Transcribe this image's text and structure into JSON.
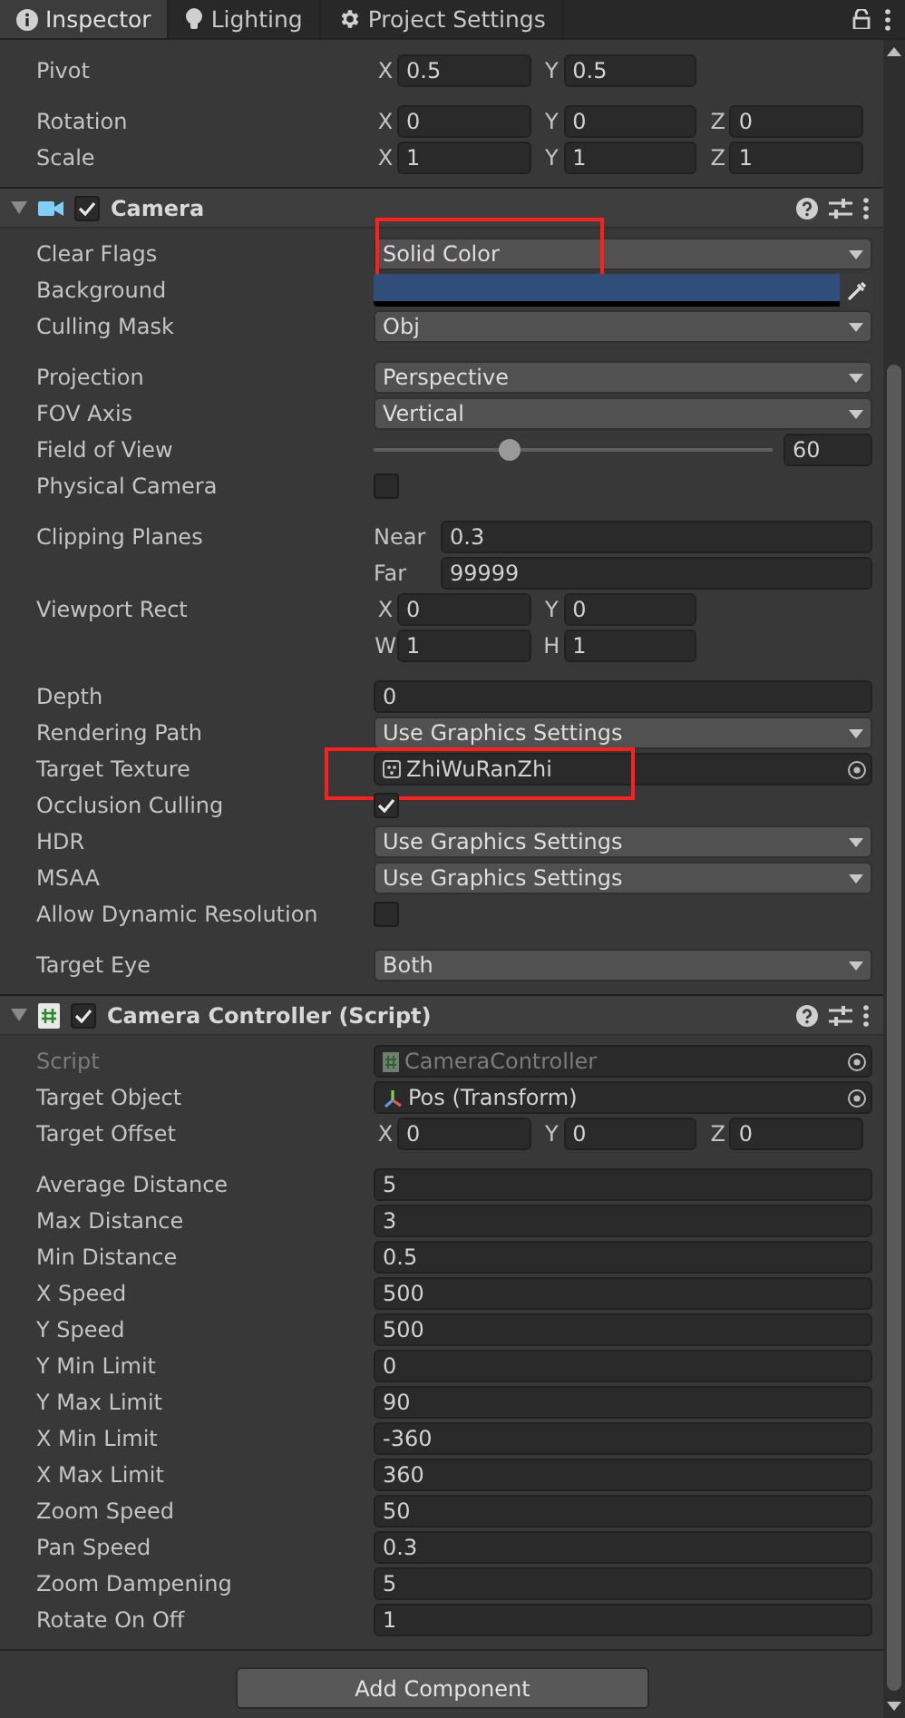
{
  "tabs": [
    {
      "label": "Inspector",
      "kind": "info",
      "selected": true
    },
    {
      "label": "Lighting",
      "kind": "bulb",
      "selected": false
    },
    {
      "label": "Project Settings",
      "kind": "gear",
      "selected": false
    }
  ],
  "components": [
    {
      "kind": "tail",
      "rows": [
        {
          "kind": "vector",
          "label": "Pivot",
          "fields": [
            {
              "axis": "X",
              "value": "0.5"
            },
            {
              "axis": "Y",
              "value": "0.5"
            }
          ]
        },
        {
          "kind": "vector",
          "label": "Rotation",
          "spaced": true,
          "fields": [
            {
              "axis": "X",
              "value": "0"
            },
            {
              "axis": "Y",
              "value": "0"
            },
            {
              "axis": "Z",
              "value": "0"
            }
          ]
        },
        {
          "kind": "vector",
          "label": "Scale",
          "fields": [
            {
              "axis": "X",
              "value": "1"
            },
            {
              "axis": "Y",
              "value": "1"
            },
            {
              "axis": "Z",
              "value": "1"
            }
          ]
        }
      ]
    },
    {
      "kind": "camera",
      "title": "Camera",
      "expanded": true,
      "enabled": true,
      "rows": [
        {
          "kind": "dropdown",
          "label": "Clear Flags",
          "value": "Solid Color",
          "highlighted": true
        },
        {
          "kind": "color",
          "label": "Background",
          "color": "#314d79"
        },
        {
          "kind": "dropdown",
          "label": "Culling Mask",
          "value": "Obj"
        },
        {
          "kind": "dropdown",
          "label": "Projection",
          "value": "Perspective",
          "spaced": true
        },
        {
          "kind": "dropdown",
          "label": "FOV Axis",
          "value": "Vertical"
        },
        {
          "kind": "slider",
          "label": "Field of View",
          "level": 0.34,
          "value": "60"
        },
        {
          "kind": "checkbox",
          "label": "Physical Camera",
          "checked": false
        },
        {
          "kind": "named",
          "label": "Clipping Planes",
          "spaced": true,
          "fields": [
            {
              "axis": "Near",
              "value": "0.3"
            }
          ]
        },
        {
          "kind": "named",
          "fields": [
            {
              "axis": "Far",
              "value": "99999"
            }
          ]
        },
        {
          "kind": "vector",
          "label": "Viewport Rect",
          "fields": [
            {
              "axis": "X",
              "value": "0"
            },
            {
              "axis": "Y",
              "value": "0"
            }
          ]
        },
        {
          "kind": "vector",
          "fields": [
            {
              "axis": "W",
              "value": "1"
            },
            {
              "axis": "H",
              "value": "1"
            }
          ]
        },
        {
          "kind": "number",
          "label": "Depth",
          "value": "0",
          "spaced": true
        },
        {
          "kind": "dropdown",
          "label": "Rendering Path",
          "value": "Use Graphics Settings"
        },
        {
          "kind": "texture",
          "label": "Target Texture",
          "value": "ZhiWuRanZhi",
          "disabled": false,
          "highlighted": true
        },
        {
          "kind": "checkbox",
          "label": "Occlusion Culling",
          "checked": true
        },
        {
          "kind": "dropdown",
          "label": "HDR",
          "value": "Use Graphics Settings"
        },
        {
          "kind": "dropdown",
          "label": "MSAA",
          "value": "Use Graphics Settings"
        },
        {
          "kind": "checkbox",
          "label": "Allow Dynamic Resolution",
          "checked": false
        },
        {
          "kind": "dropdown",
          "label": "Target Eye",
          "value": "Both",
          "spaced": true
        }
      ]
    },
    {
      "kind": "script",
      "title": "Camera Controller (Script)",
      "expanded": true,
      "enabled": true,
      "rows": [
        {
          "kind": "script",
          "label": "Script",
          "value": "CameraController",
          "disabled": true
        },
        {
          "kind": "transform",
          "label": "Target Object",
          "value": "Pos (Transform)",
          "disabled": false
        },
        {
          "kind": "vector",
          "label": "Target Offset",
          "fields": [
            {
              "axis": "X",
              "value": "0"
            },
            {
              "axis": "Y",
              "value": "0"
            },
            {
              "axis": "Z",
              "value": "0"
            }
          ]
        },
        {
          "kind": "number",
          "label": "Average Distance",
          "value": "5",
          "spaced": true
        },
        {
          "kind": "number",
          "label": "Max Distance",
          "value": "3"
        },
        {
          "kind": "number",
          "label": "Min Distance",
          "value": "0.5"
        },
        {
          "kind": "number",
          "label": "X Speed",
          "value": "500"
        },
        {
          "kind": "number",
          "label": "Y Speed",
          "value": "500"
        },
        {
          "kind": "number",
          "label": "Y Min Limit",
          "value": "0"
        },
        {
          "kind": "number",
          "label": "Y Max Limit",
          "value": "90"
        },
        {
          "kind": "number",
          "label": "X Min Limit",
          "value": "-360"
        },
        {
          "kind": "number",
          "label": "X Max Limit",
          "value": "360"
        },
        {
          "kind": "number",
          "label": "Zoom Speed",
          "value": "50"
        },
        {
          "kind": "number",
          "label": "Pan Speed",
          "value": "0.3"
        },
        {
          "kind": "number",
          "label": "Zoom Dampening",
          "value": "5"
        },
        {
          "kind": "number",
          "label": "Rotate On Off",
          "value": "1"
        }
      ]
    }
  ],
  "add_button": "Add Component"
}
